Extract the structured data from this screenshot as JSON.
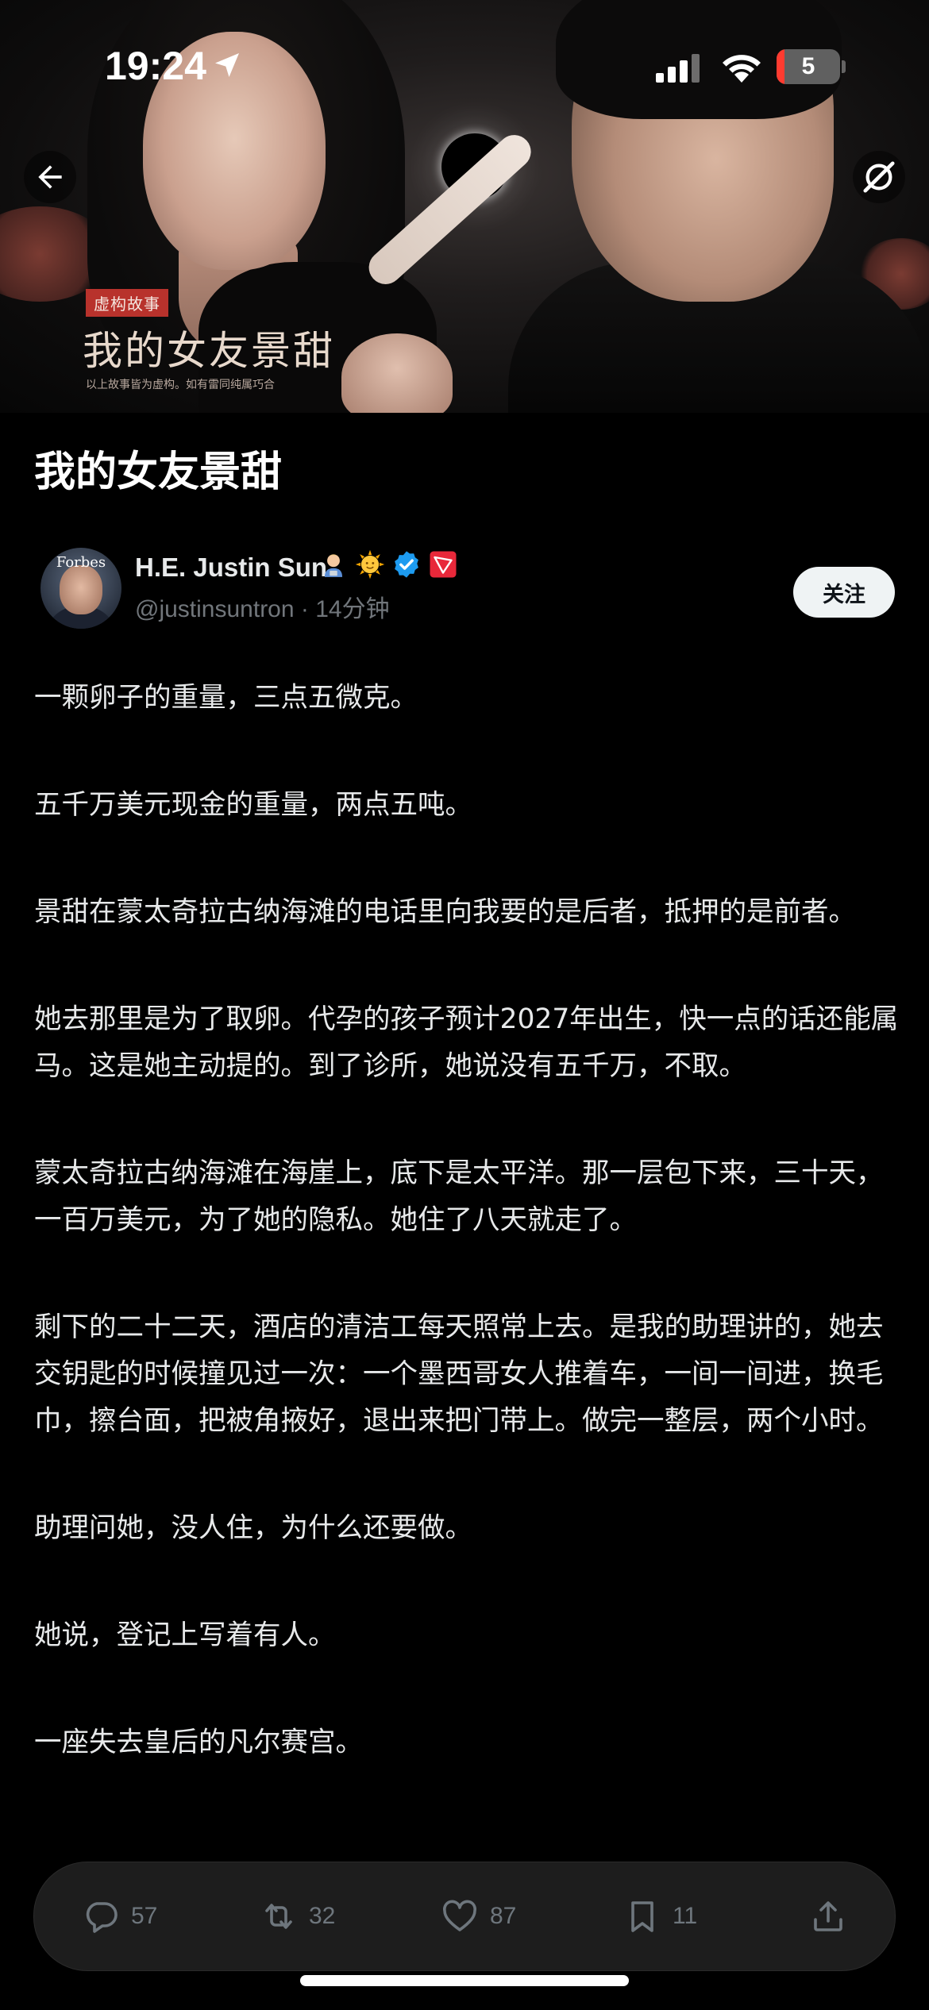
{
  "status_bar": {
    "time": "19:24",
    "battery_level": "5",
    "battery_fraction": 0.05
  },
  "cover": {
    "tag": "虚构故事",
    "title": "我的女友景甜",
    "disclaimer": "以上故事皆为虚构。如有雷同纯属巧合"
  },
  "article": {
    "title": "我的女友景甜",
    "author": {
      "avatar_text": "Forbes",
      "name": "H.E. Justin Sun",
      "name_emojis": [
        "technologist-icon",
        "sun-face-icon",
        "verified-badge-icon",
        "tron-logo-icon"
      ],
      "meta": "@justinsuntron · 14分钟",
      "follow_label": "关注"
    },
    "paragraphs": [
      "一颗卵子的重量，三点五微克。",
      "五千万美元现金的重量，两点五吨。",
      "景甜在蒙太奇拉古纳海滩的电话里向我要的是后者，抵押的是前者。",
      "她去那里是为了取卵。代孕的孩子预计2027年出生，快一点的话还能属马。这是她主动提的。到了诊所，她说没有五千万，不取。",
      "蒙太奇拉古纳海滩在海崖上，底下是太平洋。那一层包下来，三十天，一百万美元，为了她的隐私。她住了八天就走了。",
      "剩下的二十二天，酒店的清洁工每天照常上去。是我的助理讲的，她去交钥匙的时候撞见过一次：一个墨西哥女人推着车，一间一间进，换毛巾，擦台面，把被角掖好，退出来把门带上。做完一整层，两个小时。",
      "助理问她，没人住，为什么还要做。",
      "她说，登记上写着有人。",
      "一座失去皇后的凡尔赛宫。"
    ]
  },
  "actions": {
    "replies": "57",
    "reposts": "32",
    "likes": "87",
    "bookmarks": "11"
  },
  "colors": {
    "background": "#000000",
    "text": "#e7e9ea",
    "muted": "#71767b",
    "verified": "#1d9bf0",
    "battery_low": "#ff3b30"
  }
}
